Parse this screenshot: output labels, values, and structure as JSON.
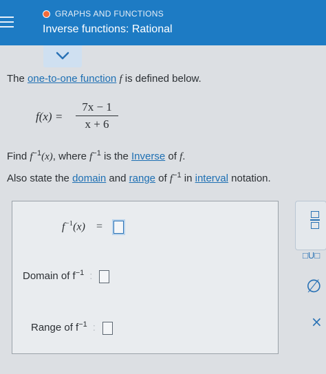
{
  "header": {
    "section_label": "GRAPHS AND FUNCTIONS",
    "topic_title": "Inverse functions: Rational"
  },
  "problem": {
    "intro_prefix": "The ",
    "intro_link": "one-to-one function",
    "intro_var": "f",
    "intro_suffix": " is defined below.",
    "function_lhs": "f(x) = ",
    "numerator": "7x − 1",
    "denominator": "x + 6",
    "find_prefix": "Find ",
    "find_f": "f",
    "find_exp": "−1",
    "find_arg": "(x)",
    "find_mid": ", where ",
    "find_f2": "f",
    "find_exp2": "−1",
    "find_is": " is the ",
    "inverse_link": "Inverse",
    "find_of": " of ",
    "find_end_f": "f",
    "find_end": ".",
    "also_prefix": "Also state the ",
    "domain_link": "domain",
    "also_and": " and ",
    "range_link": "range",
    "also_of": " of ",
    "also_f": "f",
    "also_exp": "−1",
    "also_in": " in ",
    "interval_link": "interval",
    "also_notation": " notation."
  },
  "answer": {
    "inverse_f": "f",
    "inverse_exp": "−1",
    "inverse_arg": "(x)",
    "equals": "=",
    "domain_label": "Domain of f",
    "domain_exp": "−1",
    "domain_sep": ":",
    "range_label": "Range of f",
    "range_exp": "−1",
    "range_sep": ":"
  },
  "tools": {
    "union_label": "□U□",
    "empty_set_symbol": "∅",
    "clear_symbol": "×"
  },
  "colors": {
    "header_bg": "#1d7bc4",
    "accent": "#2a72b5",
    "status_dot": "#f26b3a"
  }
}
